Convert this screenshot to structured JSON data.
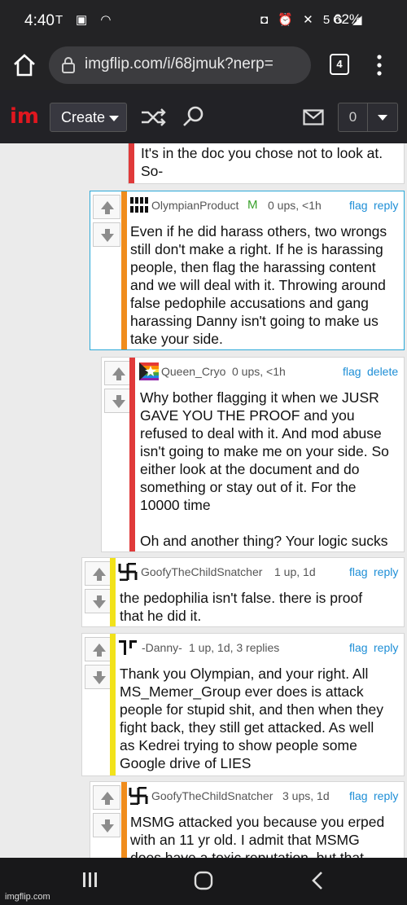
{
  "status": {
    "time": "4:40",
    "battery": "62%",
    "network": "5G"
  },
  "browser": {
    "url": "imgflip.com/i/68jmuk?nerp=",
    "tab_count": "4"
  },
  "nav": {
    "create_label": "Create",
    "notif_count": "0"
  },
  "comments": [
    {
      "bar_color": "#e03a3a",
      "text": [
        "It's in the doc you chose not to look at.",
        "So-"
      ]
    },
    {
      "bar_color": "#f08c1c",
      "user": "OlympianProduct",
      "mod": "M",
      "meta": "0 ups, <1h",
      "flag": "flag",
      "action": "reply",
      "text": [
        "Even if he did harass others, two wrongs",
        "still don't make a right. If he is harassing",
        "people, then flag the harassing content",
        "and we will deal with it. Throwing around",
        "false pedophile accusations and gang",
        "harassing Danny isn't going to make us",
        "take your side."
      ]
    },
    {
      "bar_color": "#e03a3a",
      "user": "Queen_Cryo",
      "meta": "0 ups, <1h",
      "flag": "flag",
      "action": "delete",
      "text": [
        "Why bother flagging it when we JUSR",
        "GAVE YOU THE PROOF and you",
        "refused to deal with it. And mod abuse",
        "isn't going to make me on your side. So",
        "either look at the document and do",
        "something or stay out of it. For the",
        "10000 time",
        "",
        "Oh and another thing? Your logic sucks"
      ]
    },
    {
      "bar_color": "#f2e21a",
      "user": "GoofyTheChildSnatcher",
      "meta": "1 up, 1d",
      "flag": "flag",
      "action": "reply",
      "text": [
        "the pedophilia isn't false. there is proof",
        "that he did it."
      ]
    },
    {
      "bar_color": "#f2e21a",
      "user": "-Danny-",
      "meta": "1 up, 1d, 3 replies",
      "flag": "flag",
      "action": "reply",
      "text": [
        "Thank you Olympian, and your right. All",
        "MS_Memer_Group ever does is attack",
        "people for stupid shit, and then when they",
        "fight back, they still get attacked. As well",
        "as Kedrei trying to show people some",
        "Google drive of LIES"
      ]
    },
    {
      "bar_color": "#f08c1c",
      "user": "GoofyTheChildSnatcher",
      "meta": "3 ups, 1d",
      "flag": "flag",
      "action": "reply",
      "text": [
        "MSMG attacked you because you erped",
        "with an 11 yr old. I admit that MSMG",
        "does have a toxic reputation, but that"
      ]
    }
  ],
  "watermark": "imgflip.com"
}
